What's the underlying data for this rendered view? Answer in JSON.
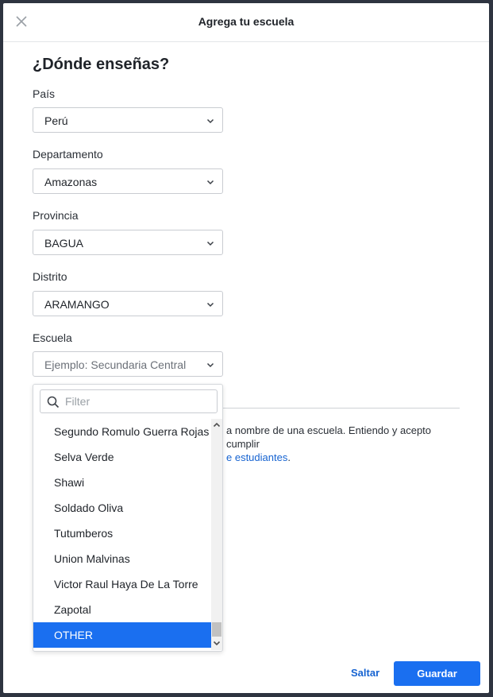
{
  "modal": {
    "title": "Agrega tu escuela",
    "heading": "¿Dónde enseñas?"
  },
  "fields": {
    "country": {
      "label": "País",
      "value": "Perú"
    },
    "department": {
      "label": "Departamento",
      "value": "Amazonas"
    },
    "province": {
      "label": "Provincia",
      "value": "BAGUA"
    },
    "district": {
      "label": "Distrito",
      "value": "ARAMANGO"
    },
    "school": {
      "label": "Escuela",
      "placeholder": "Ejemplo: Secundaria Central"
    }
  },
  "dropdown": {
    "filter_placeholder": "Filter",
    "options": [
      "Segundo Romulo Guerra Rojas",
      "Selva Verde",
      "Shawi",
      "Soldado Oliva",
      "Tutumberos",
      "Union Malvinas",
      "Victor Raul Haya De La Torre",
      "Zapotal",
      "OTHER"
    ],
    "selected": "OTHER"
  },
  "terms": {
    "text_part": "a nombre de una escuela. Entiendo y acepto cumplir",
    "link_part": "e estudiantes",
    "end_part": "."
  },
  "footer": {
    "skip_label": "Saltar",
    "save_label": "Guardar"
  },
  "icons": {
    "close": "close-icon",
    "chevron": "chevron-down-icon",
    "search": "search-icon"
  },
  "colors": {
    "accent": "#1a6ff0",
    "link": "#1663d1"
  }
}
